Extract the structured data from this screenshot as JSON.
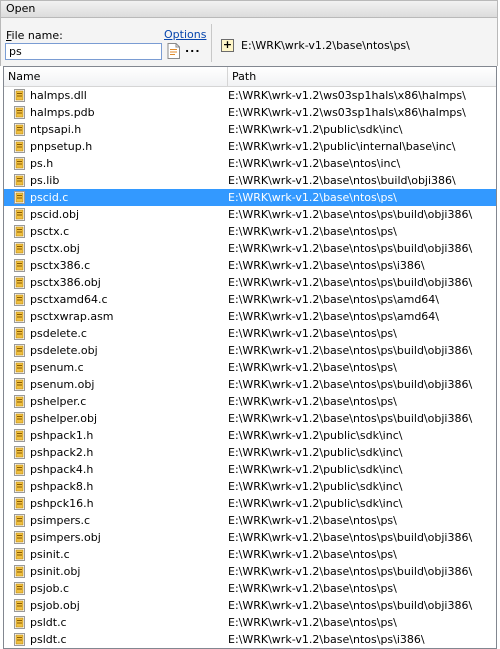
{
  "window": {
    "title": "Open"
  },
  "toolbar": {
    "file_name_label_pre": "F",
    "file_name_label_rest": "ile name:",
    "options_label": "Options",
    "file_name_value": "ps",
    "more_label": "...",
    "expand_symbol": "+",
    "current_path": "E:\\WRK\\wrk-v1.2\\base\\ntos\\ps\\"
  },
  "list": {
    "columns": {
      "name": "Name",
      "path": "Path"
    },
    "rows": [
      {
        "name": "halmps.dll",
        "path": "E:\\WRK\\wrk-v1.2\\ws03sp1hals\\x86\\halmps\\"
      },
      {
        "name": "halmps.pdb",
        "path": "E:\\WRK\\wrk-v1.2\\ws03sp1hals\\x86\\halmps\\"
      },
      {
        "name": "ntpsapi.h",
        "path": "E:\\WRK\\wrk-v1.2\\public\\sdk\\inc\\"
      },
      {
        "name": "pnpsetup.h",
        "path": "E:\\WRK\\wrk-v1.2\\public\\internal\\base\\inc\\"
      },
      {
        "name": "ps.h",
        "path": "E:\\WRK\\wrk-v1.2\\base\\ntos\\inc\\"
      },
      {
        "name": "ps.lib",
        "path": "E:\\WRK\\wrk-v1.2\\base\\ntos\\build\\obji386\\"
      },
      {
        "name": "pscid.c",
        "path": "E:\\WRK\\wrk-v1.2\\base\\ntos\\ps\\",
        "selected": true
      },
      {
        "name": "pscid.obj",
        "path": "E:\\WRK\\wrk-v1.2\\base\\ntos\\ps\\build\\obji386\\"
      },
      {
        "name": "psctx.c",
        "path": "E:\\WRK\\wrk-v1.2\\base\\ntos\\ps\\"
      },
      {
        "name": "psctx.obj",
        "path": "E:\\WRK\\wrk-v1.2\\base\\ntos\\ps\\build\\obji386\\"
      },
      {
        "name": "psctx386.c",
        "path": "E:\\WRK\\wrk-v1.2\\base\\ntos\\ps\\i386\\"
      },
      {
        "name": "psctx386.obj",
        "path": "E:\\WRK\\wrk-v1.2\\base\\ntos\\ps\\build\\obji386\\"
      },
      {
        "name": "psctxamd64.c",
        "path": "E:\\WRK\\wrk-v1.2\\base\\ntos\\ps\\amd64\\"
      },
      {
        "name": "psctxwrap.asm",
        "path": "E:\\WRK\\wrk-v1.2\\base\\ntos\\ps\\amd64\\"
      },
      {
        "name": "psdelete.c",
        "path": "E:\\WRK\\wrk-v1.2\\base\\ntos\\ps\\"
      },
      {
        "name": "psdelete.obj",
        "path": "E:\\WRK\\wrk-v1.2\\base\\ntos\\ps\\build\\obji386\\"
      },
      {
        "name": "psenum.c",
        "path": "E:\\WRK\\wrk-v1.2\\base\\ntos\\ps\\"
      },
      {
        "name": "psenum.obj",
        "path": "E:\\WRK\\wrk-v1.2\\base\\ntos\\ps\\build\\obji386\\"
      },
      {
        "name": "pshelper.c",
        "path": "E:\\WRK\\wrk-v1.2\\base\\ntos\\ps\\"
      },
      {
        "name": "pshelper.obj",
        "path": "E:\\WRK\\wrk-v1.2\\base\\ntos\\ps\\build\\obji386\\"
      },
      {
        "name": "pshpack1.h",
        "path": "E:\\WRK\\wrk-v1.2\\public\\sdk\\inc\\"
      },
      {
        "name": "pshpack2.h",
        "path": "E:\\WRK\\wrk-v1.2\\public\\sdk\\inc\\"
      },
      {
        "name": "pshpack4.h",
        "path": "E:\\WRK\\wrk-v1.2\\public\\sdk\\inc\\"
      },
      {
        "name": "pshpack8.h",
        "path": "E:\\WRK\\wrk-v1.2\\public\\sdk\\inc\\"
      },
      {
        "name": "pshpck16.h",
        "path": "E:\\WRK\\wrk-v1.2\\public\\sdk\\inc\\"
      },
      {
        "name": "psimpers.c",
        "path": "E:\\WRK\\wrk-v1.2\\base\\ntos\\ps\\"
      },
      {
        "name": "psimpers.obj",
        "path": "E:\\WRK\\wrk-v1.2\\base\\ntos\\ps\\build\\obji386\\"
      },
      {
        "name": "psinit.c",
        "path": "E:\\WRK\\wrk-v1.2\\base\\ntos\\ps\\"
      },
      {
        "name": "psinit.obj",
        "path": "E:\\WRK\\wrk-v1.2\\base\\ntos\\ps\\build\\obji386\\"
      },
      {
        "name": "psjob.c",
        "path": "E:\\WRK\\wrk-v1.2\\base\\ntos\\ps\\"
      },
      {
        "name": "psjob.obj",
        "path": "E:\\WRK\\wrk-v1.2\\base\\ntos\\ps\\build\\obji386\\"
      },
      {
        "name": "psldt.c",
        "path": "E:\\WRK\\wrk-v1.2\\base\\ntos\\ps\\"
      },
      {
        "name": "psldt.c",
        "path": "E:\\WRK\\wrk-v1.2\\base\\ntos\\ps\\i386\\"
      }
    ]
  },
  "colors": {
    "selection": "#3399ff",
    "link": "#0645ad"
  },
  "icons": {
    "row": "file-icon",
    "browse": "browse-file-icon"
  }
}
